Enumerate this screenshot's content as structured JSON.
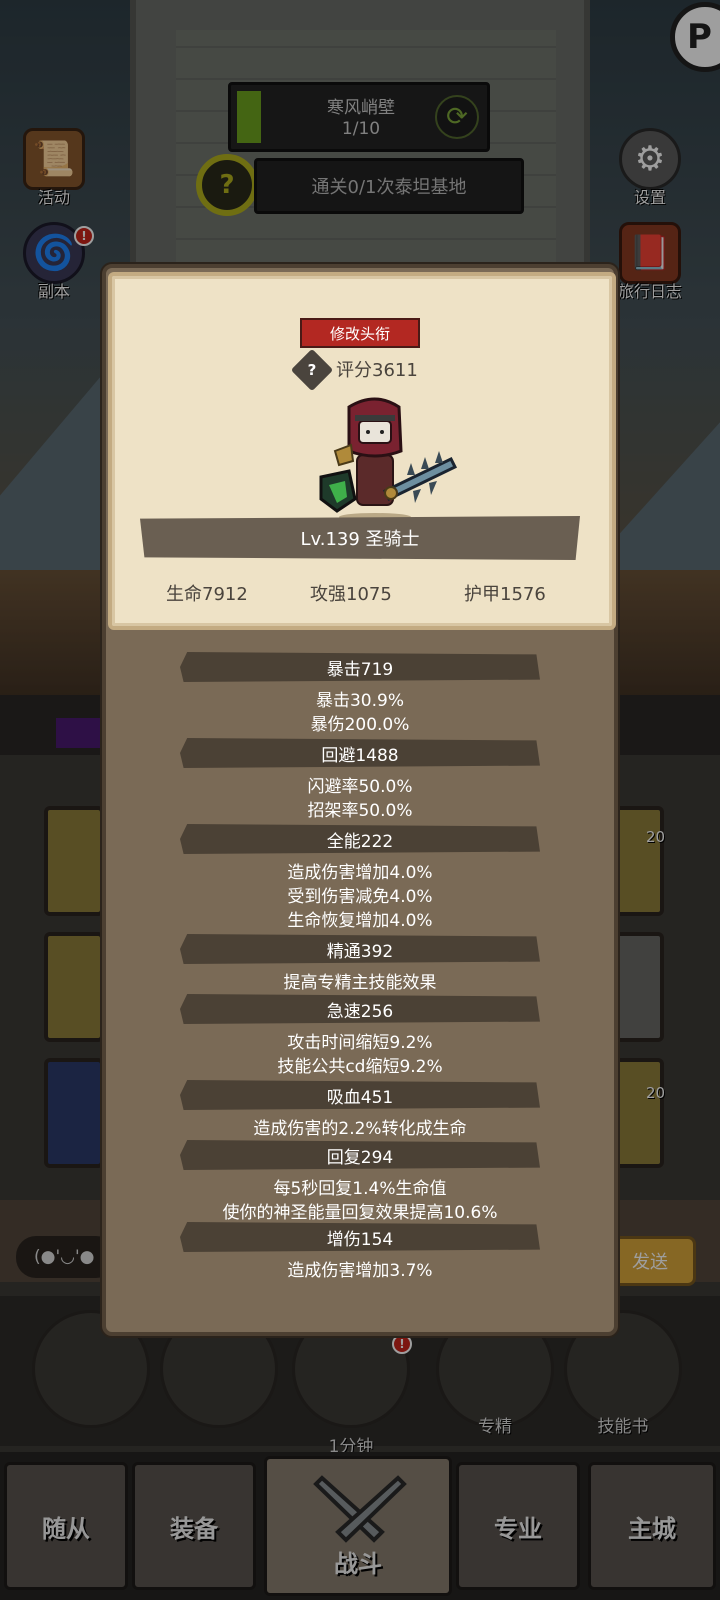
{
  "hud": {
    "stage_name": "寒风峭壁",
    "stage_progress": "1/10",
    "stage_fill_fraction": 0.1,
    "quest_text": "通关0/1次泰坦基地",
    "quest_icon": "?",
    "logo_glyph": "P"
  },
  "side_left": [
    {
      "label": "活动",
      "icon": "scroll-icon"
    },
    {
      "label": "副本",
      "icon": "portal-icon",
      "badge": "!"
    }
  ],
  "side_right": [
    {
      "label": "设置",
      "icon": "gear-icon"
    },
    {
      "label": "旅行日志",
      "icon": "book-icon"
    }
  ],
  "inventory": {
    "counts": [
      "20",
      "20"
    ]
  },
  "chat": {
    "input_text": "(●'◡'●",
    "send_label": "发送"
  },
  "actions": [
    {
      "label": ""
    },
    {
      "label": ""
    },
    {
      "label": "1分钟",
      "badge": "!"
    },
    {
      "label": "专精"
    },
    {
      "label": "技能书"
    }
  ],
  "nav": {
    "tabs": [
      "随从",
      "装备",
      "战斗",
      "专业",
      "主城"
    ],
    "active": "战斗"
  },
  "profile": {
    "title_button": "修改头衔",
    "score_label": "评分3611",
    "score_help": "?",
    "level_class": "Lv.139 圣骑士",
    "base_stats": [
      "生命7912",
      "攻强1075",
      "护甲1576"
    ]
  },
  "stats": [
    {
      "header": "暴击719",
      "lines": [
        "暴击30.9%",
        "暴伤200.0%"
      ]
    },
    {
      "header": "回避1488",
      "lines": [
        "闪避率50.0%",
        "招架率50.0%"
      ]
    },
    {
      "header": "全能222",
      "lines": [
        "造成伤害增加4.0%",
        "受到伤害减免4.0%",
        "生命恢复增加4.0%"
      ]
    },
    {
      "header": "精通392",
      "lines": [
        "提高专精主技能效果"
      ]
    },
    {
      "header": "急速256",
      "lines": [
        "攻击时间缩短9.2%",
        "技能公共cd缩短9.2%"
      ]
    },
    {
      "header": "吸血451",
      "lines": [
        "造成伤害的2.2%转化成生命"
      ]
    },
    {
      "header": "回复294",
      "lines": [
        "每5秒回复1.4%生命值",
        "使你的神圣能量回复效果提高10.6%"
      ]
    },
    {
      "header": "增伤154",
      "lines": [
        "造成伤害增加3.7%"
      ]
    }
  ]
}
